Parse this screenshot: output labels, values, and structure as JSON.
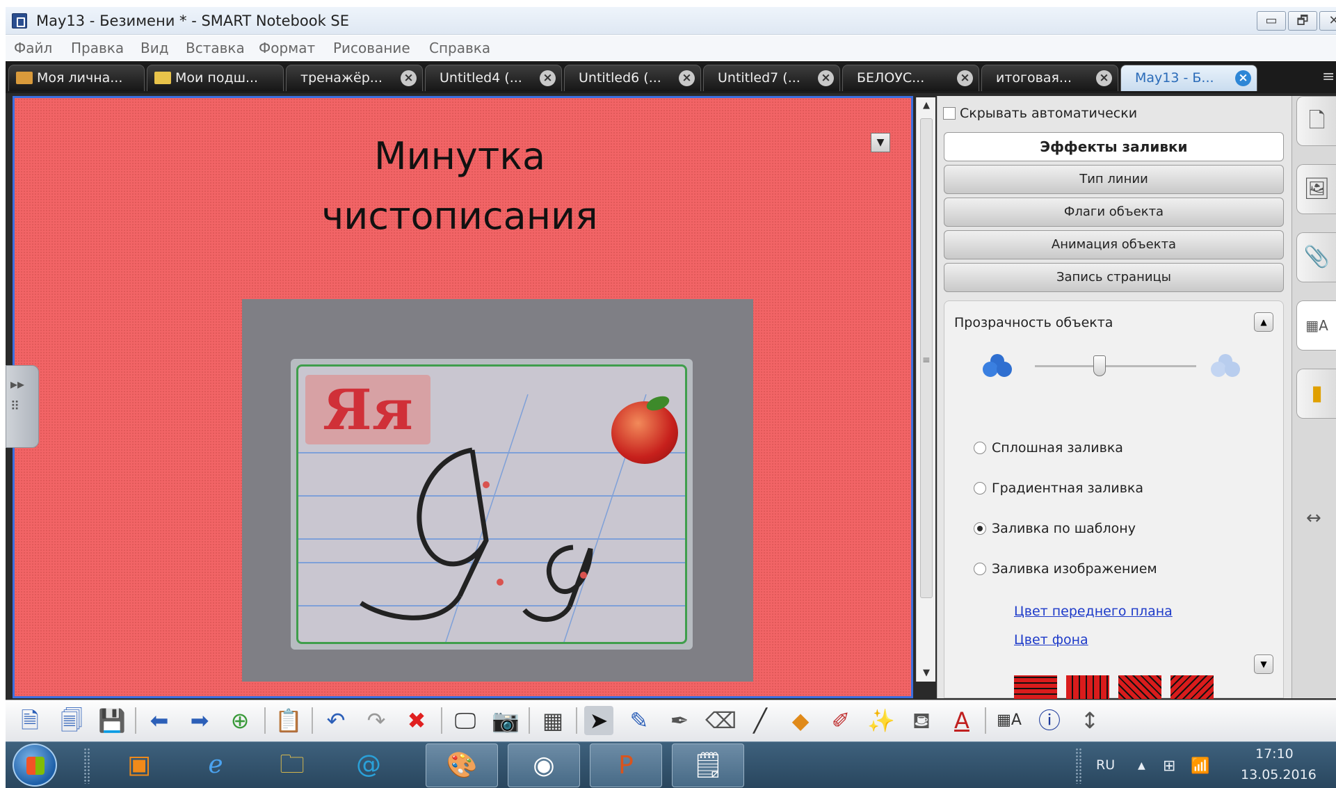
{
  "window": {
    "title": "May13 - Безимени * - SMART Notebook SE",
    "minimize": "▭",
    "restore": "🗗",
    "close": "✕"
  },
  "menu": [
    "Файл",
    "Правка",
    "Вид",
    "Вставка",
    "Формат",
    "Рисование",
    "Справка"
  ],
  "tabs": [
    {
      "label": "Моя лична...",
      "icon": "house-icon",
      "closable": false
    },
    {
      "label": "Мои подш...",
      "icon": "folder-icon",
      "closable": false
    },
    {
      "label": "тренажёр...",
      "closable": true
    },
    {
      "label": "Untitled4 (...",
      "closable": true
    },
    {
      "label": "Untitled6 (...",
      "closable": true
    },
    {
      "label": "Untitled7 (...",
      "closable": true
    },
    {
      "label": "БЕЛОУС...",
      "closable": true
    },
    {
      "label": "итоговая...",
      "closable": true
    },
    {
      "label": "May13 - Б...",
      "closable": true,
      "active": true
    }
  ],
  "canvas": {
    "title_line1": "Минутка",
    "title_line2": "чистописания",
    "card_label": "Яя",
    "background": "#f26466"
  },
  "props": {
    "autohide": "Скрывать автоматически",
    "buttons": [
      "Эффекты заливки",
      "Тип линии",
      "Флаги объекта",
      "Анимация объекта",
      "Запись страницы"
    ],
    "section_title": "Прозрачность объекта",
    "opacity_level": 0.4,
    "fill_options": [
      "Сплошная заливка",
      "Градиентная заливка",
      "Заливка по шаблону",
      "Заливка изображением"
    ],
    "selected_fill": 2,
    "link_foreground": "Цвет переднего плана",
    "link_background": "Цвет фона"
  },
  "side_tabs": [
    "page-sorter-icon",
    "gallery-icon",
    "attachments-icon",
    "properties-icon",
    "addons-icon"
  ],
  "toolbar": [
    "new-page-icon",
    "open-icon",
    "save-icon",
    "back-icon",
    "forward-icon",
    "add-page-icon",
    "paste-icon",
    "undo-icon",
    "redo-icon",
    "delete-icon",
    "screen-icon",
    "camera-icon",
    "table-icon",
    "select-icon",
    "pen-icon",
    "creative-pen-icon",
    "eraser-icon",
    "line-icon",
    "shapes-icon",
    "magic-pen-icon",
    "fill-icon",
    "text-icon",
    "properties-icon",
    "info-icon",
    "move-toolbar-icon"
  ],
  "taskbar": {
    "lang": "RU",
    "time": "17:10",
    "date": "13.05.2016"
  }
}
